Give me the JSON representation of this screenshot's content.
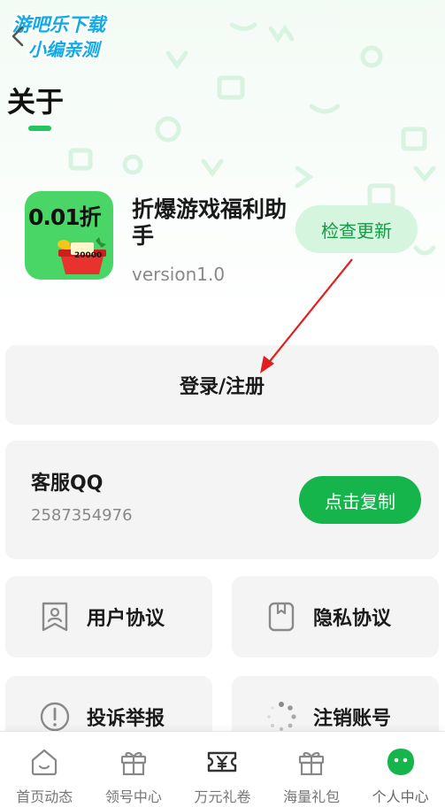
{
  "watermark": {
    "line1": "游吧乐下载",
    "line2": "小编亲测"
  },
  "header": {
    "title": "关于",
    "back_icon": "chevron-left-icon"
  },
  "app": {
    "icon_text": "0.01折",
    "icon_number": "20000",
    "name": "折爆游戏福利助手",
    "version": "version1.0",
    "check_update_label": "检查更新"
  },
  "login": {
    "label": "登录/注册"
  },
  "customer_service": {
    "label": "客服QQ",
    "number": "2587354976",
    "copy_label": "点击复制"
  },
  "tiles": [
    {
      "label": "用户协议",
      "icon": "user-agreement-icon"
    },
    {
      "label": "隐私协议",
      "icon": "privacy-icon"
    },
    {
      "label": "投诉举报",
      "icon": "report-icon"
    },
    {
      "label": "注销账号",
      "icon": "loading-icon"
    }
  ],
  "tabbar": {
    "items": [
      {
        "label": "首页动态",
        "icon": "home-icon"
      },
      {
        "label": "领号中心",
        "icon": "gift-icon"
      },
      {
        "label": "万元礼卷",
        "icon": "voucher-icon"
      },
      {
        "label": "海量礼包",
        "icon": "gift-box-icon"
      },
      {
        "label": "个人中心",
        "icon": "profile-icon"
      }
    ],
    "active_index": 4
  },
  "colors": {
    "accent": "#16b54c",
    "accent_light": "#d5f5df",
    "card_bg": "#f4f4f4",
    "annotation_arrow": "#e02020",
    "watermark": "#11a9e8"
  }
}
